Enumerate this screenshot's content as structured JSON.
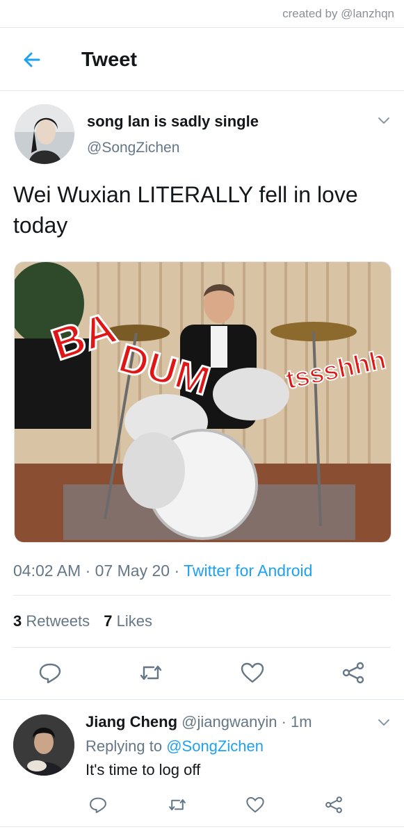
{
  "credit": "created by @lanzhqn",
  "header": {
    "title": "Tweet"
  },
  "tweet": {
    "display_name": "song lan is sadly single",
    "handle": "@SongZichen",
    "text": "Wei Wuxian LITERALLY fell in love today",
    "media": {
      "overlay_ba": "BA",
      "overlay_dum": "DUM",
      "overlay_tss": "tssshhh"
    },
    "time": "04:02 AM",
    "sep1": "·",
    "date": "07 May 20",
    "sep2": "·",
    "source": "Twitter for Android",
    "retweets_count": "3",
    "retweets_label": "Retweets",
    "likes_count": "7",
    "likes_label": "Likes"
  },
  "reply": {
    "name": "Jiang Cheng",
    "handle": "@jiangwanyin",
    "sep": "·",
    "age": "1m",
    "replying_prefix": "Replying to",
    "replying_to": "@SongZichen",
    "text": "It's time to log off"
  },
  "colors": {
    "accent": "#1da1f2",
    "secondary_text": "#657786",
    "divider": "#e1e8ed"
  },
  "icons": [
    "back-arrow-icon",
    "chevron-down-icon",
    "reply-icon",
    "retweet-icon",
    "like-icon",
    "share-icon"
  ]
}
